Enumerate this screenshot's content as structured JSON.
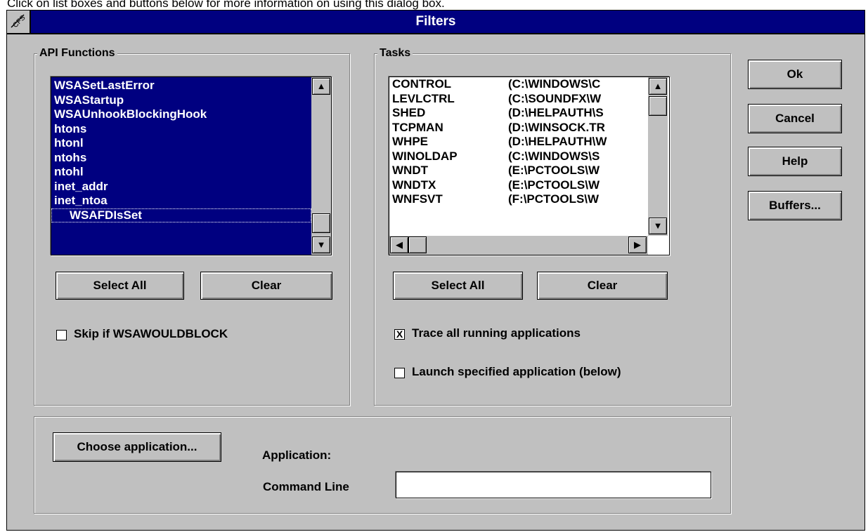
{
  "caption": "Click on list boxes and buttons below for more information on using this dialog box.",
  "window": {
    "title": "Filters"
  },
  "api_group": {
    "label": "API Functions",
    "items": [
      "WSASetLastError",
      "WSAStartup",
      "WSAUnhookBlockingHook",
      "htons",
      "htonl",
      "ntohs",
      "ntohl",
      "inet_addr",
      "inet_ntoa",
      "WSAFDIsSet"
    ],
    "select_all": "Select All",
    "clear": "Clear",
    "skip_label": "Skip if WSAWOULDBLOCK"
  },
  "tasks_group": {
    "label": "Tasks",
    "items": [
      {
        "name": "CONTROL",
        "path": "(C:\\WINDOWS\\C"
      },
      {
        "name": "LEVLCTRL",
        "path": "(C:\\SOUNDFX\\W"
      },
      {
        "name": "SHED",
        "path": "(D:\\HELPAUTH\\S"
      },
      {
        "name": "TCPMAN",
        "path": "(D:\\WINSOCK.TR"
      },
      {
        "name": "WHPE",
        "path": "(D:\\HELPAUTH\\W"
      },
      {
        "name": "WINOLDAP",
        "path": "(C:\\WINDOWS\\S"
      },
      {
        "name": "WNDT",
        "path": "(E:\\PCTOOLS\\W"
      },
      {
        "name": "WNDTX",
        "path": "(E:\\PCTOOLS\\W"
      },
      {
        "name": "WNFSVT",
        "path": "(F:\\PCTOOLS\\W"
      }
    ],
    "select_all": "Select All",
    "clear": "Clear",
    "trace_label": "Trace all running applications",
    "trace_checked": true,
    "launch_label": "Launch specified application (below)",
    "launch_checked": false
  },
  "buttons": {
    "ok": "Ok",
    "cancel": "Cancel",
    "help": "Help",
    "buffers": "Buffers..."
  },
  "app_group": {
    "choose_button": "Choose application...",
    "application_label": "Application:",
    "command_line_label": "Command Line",
    "command_line_value": ""
  },
  "icons": {
    "scroll_up": "▲",
    "scroll_down": "▼",
    "scroll_left": "◀",
    "scroll_right": "▶",
    "check_mark": "X"
  }
}
